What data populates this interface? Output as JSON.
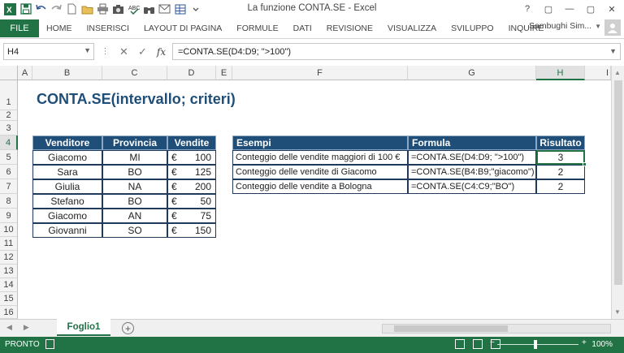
{
  "window": {
    "title": "La funzione CONTA.SE - Excel",
    "controls": [
      "?",
      "▢",
      "—",
      "▢",
      "✕"
    ]
  },
  "qat_icons": [
    "excel-logo-icon",
    "save-icon",
    "undo-icon",
    "redo-icon",
    "new-file-icon",
    "open-folder-icon",
    "print-icon",
    "camera-icon",
    "spell-check-icon",
    "binoculars-icon",
    "email-icon",
    "table-icon",
    "chevron-down-icon"
  ],
  "ribbon": {
    "file": "FILE",
    "tabs": [
      "HOME",
      "INSERISCI",
      "LAYOUT DI PAGINA",
      "FORMULE",
      "DATI",
      "REVISIONE",
      "VISUALIZZA",
      "SVILUPPO",
      "INQUIRE"
    ],
    "user": "Sambughi Sim..."
  },
  "formula_bar": {
    "name_box": "H4",
    "formula": "=CONTA.SE(D4:D9; \">100\")"
  },
  "columns": [
    "A",
    "B",
    "C",
    "D",
    "E",
    "F",
    "G",
    "H",
    "I"
  ],
  "rows": [
    "1",
    "2",
    "3",
    "4",
    "5",
    "6",
    "7",
    "8",
    "9",
    "10",
    "11",
    "12",
    "13",
    "14",
    "15",
    "16"
  ],
  "sheet_title": "CONTA.SE(intervallo; criteri)",
  "sales_table": {
    "headers": [
      "Venditore",
      "Provincia",
      "Vendite"
    ],
    "currency": "€",
    "rows": [
      {
        "venditore": "Giacomo",
        "provincia": "MI",
        "vendite": "100"
      },
      {
        "venditore": "Sara",
        "provincia": "BO",
        "vendite": "125"
      },
      {
        "venditore": "Giulia",
        "provincia": "NA",
        "vendite": "200"
      },
      {
        "venditore": "Stefano",
        "provincia": "BO",
        "vendite": "50"
      },
      {
        "venditore": "Giacomo",
        "provincia": "AN",
        "vendite": "75"
      },
      {
        "venditore": "Giovanni",
        "provincia": "SO",
        "vendite": "150"
      }
    ]
  },
  "examples_table": {
    "headers": [
      "Esempi",
      "Formula",
      "Risultato"
    ],
    "rows": [
      {
        "esempio": "Conteggio delle vendite maggiori di 100 €",
        "formula": "=CONTA.SE(D4:D9; \">100\")",
        "risultato": "3"
      },
      {
        "esempio": "Conteggio delle vendite di Giacomo",
        "formula": "=CONTA.SE(B4:B9;\"giacomo\")",
        "risultato": "2"
      },
      {
        "esempio": "Conteggio delle vendite a Bologna",
        "formula": "=CONTA.SE(C4:C9;\"BO\")",
        "risultato": "2"
      }
    ]
  },
  "sheet_tabs": {
    "active": "Foglio1"
  },
  "status": {
    "ready": "PRONTO",
    "zoom": "100%"
  },
  "colors": {
    "excel_green": "#217346",
    "header_blue": "#1f4e79"
  }
}
